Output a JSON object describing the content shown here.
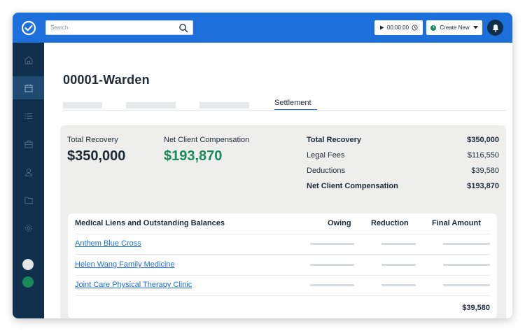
{
  "header": {
    "search_placeholder": "Search",
    "timer": "00:00:00",
    "create_label": "Create New"
  },
  "sidebar": {
    "items": [
      "home-icon",
      "calendar-icon",
      "list-icon",
      "briefcase-icon",
      "user-icon",
      "folder-icon",
      "gear-icon"
    ],
    "active": "calendar-icon",
    "avatar_colors": [
      "#e2e4e6",
      "#1a8a5a"
    ]
  },
  "case": {
    "title": "00001-Warden",
    "active_tab": "Settlement"
  },
  "stats": {
    "total_recovery_label": "Total Recovery",
    "total_recovery_value": "$350,000",
    "net_comp_label": "Net Client Compensation",
    "net_comp_value": "$193,870"
  },
  "summary": {
    "rows": [
      {
        "label": "Total Recovery",
        "value": "$350,000"
      },
      {
        "label": "Legal Fees",
        "value": "$116,550"
      },
      {
        "label": "Deductions",
        "value": "$39,580"
      },
      {
        "label": "Net Client Compensation",
        "value": "$193,870"
      }
    ]
  },
  "liens": {
    "header": "Medical Liens and Outstanding Balances",
    "col_owing": "Owing",
    "col_reduction": "Reduction",
    "col_final": "Final Amount",
    "rows": [
      {
        "name": "Anthem Blue Cross"
      },
      {
        "name": "Helen Wang Family Medicine"
      },
      {
        "name": "Joint Care Physical Therapy Clinic"
      }
    ],
    "total": "$39,580"
  },
  "colors": {
    "topbar": "#1d6fdb",
    "sidebar": "#0f2f4d",
    "accent_green": "#1a8a5a",
    "link": "#1d6fdb"
  }
}
